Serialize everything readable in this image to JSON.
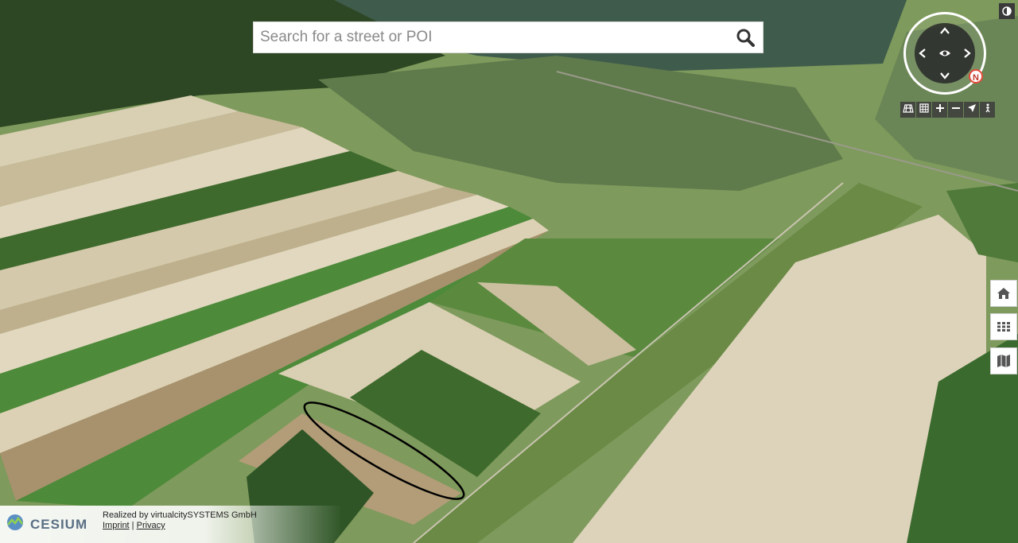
{
  "search": {
    "placeholder": "Search for a street or POI",
    "button_icon": "search-icon"
  },
  "compass": {
    "north_label": "N",
    "icons": [
      "arrow-up-icon",
      "arrow-down-icon",
      "arrow-left-icon",
      "arrow-right-icon",
      "eye-icon"
    ]
  },
  "nav_toolbar": {
    "items": [
      {
        "name": "3d-view-icon",
        "glyph": "▦"
      },
      {
        "name": "grid-icon",
        "glyph": "▦"
      },
      {
        "name": "zoom-in-icon",
        "glyph": "+"
      },
      {
        "name": "zoom-out-icon",
        "glyph": "−"
      },
      {
        "name": "locate-icon",
        "glyph": "➤"
      },
      {
        "name": "person-icon",
        "glyph": "i"
      }
    ]
  },
  "side_buttons": [
    "home-icon",
    "layers-grid-icon",
    "map-icon"
  ],
  "footer": {
    "logo_text": "CESIUM",
    "credit_text": "Realized by virtualcitySYSTEMS GmbH",
    "imprint_label": "Imprint",
    "separator": " | ",
    "privacy_label": "Privacy"
  },
  "colors": {
    "accent_north": "#e74c3c",
    "forest": "#2e4a23",
    "field_light": "#d8cdb0",
    "field_green": "#4f8a3a",
    "water": "#3d5a4a"
  }
}
